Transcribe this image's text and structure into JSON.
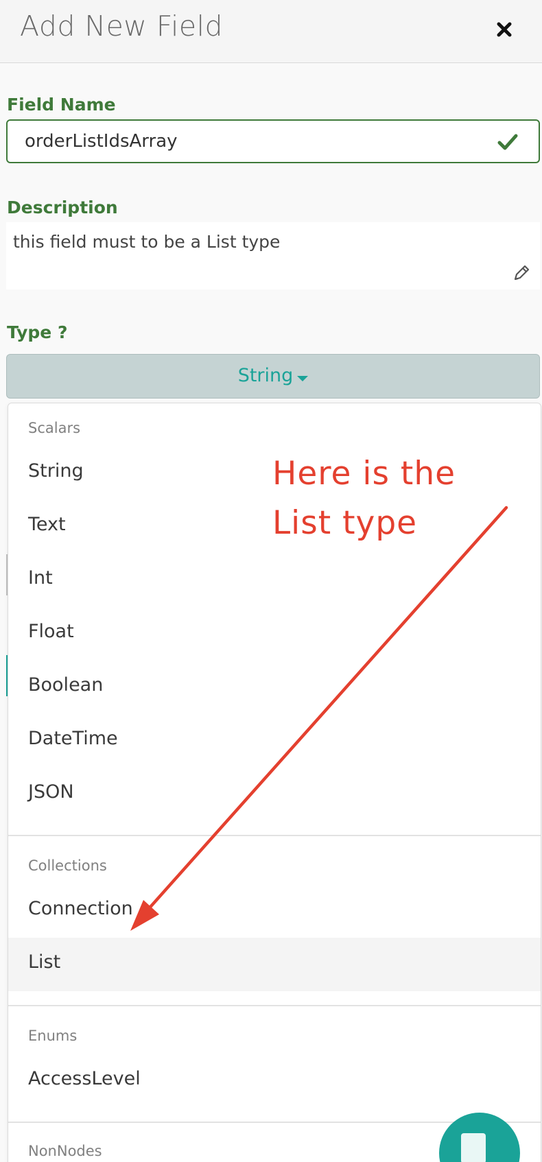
{
  "header": {
    "title": "Add New Field",
    "close_icon": "close-icon"
  },
  "field_name": {
    "label": "Field Name",
    "value": "orderListIdsArray",
    "valid_icon": "check-icon"
  },
  "description": {
    "label": "Description",
    "value": "this field must to be a List type",
    "edit_icon": "pencil-icon"
  },
  "type": {
    "label": "Type ?",
    "selected": "String"
  },
  "dropdown": {
    "groups": [
      {
        "label": "Scalars",
        "items": [
          "String",
          "Text",
          "Int",
          "Float",
          "Boolean",
          "DateTime",
          "JSON"
        ]
      },
      {
        "label": "Collections",
        "items": [
          "Connection",
          "List"
        ]
      },
      {
        "label": "Enums",
        "items": [
          "AccessLevel"
        ]
      },
      {
        "label": "NonNodes",
        "items": []
      }
    ],
    "highlighted": "List"
  },
  "annotation": {
    "line1": "Here is the",
    "line2": "List type",
    "color": "#e4402f"
  },
  "colors": {
    "accent_green": "#3f7a3a",
    "teal": "#1aa398",
    "type_button_bg": "#c5d3d3"
  }
}
